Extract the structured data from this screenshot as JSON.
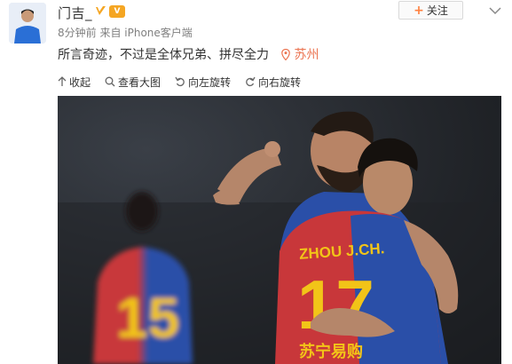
{
  "post": {
    "user_name": "门吉_",
    "vip_label": "V",
    "time": "8分钟前",
    "source": "来自 iPhone客户端",
    "follow_label": "关注",
    "text": "所言奇迹，不过是全体兄弟、拼尽全力",
    "location": "苏州"
  },
  "toolbar": {
    "collapse": "收起",
    "view_large": "查看大图",
    "rotate_left": "向左旋转",
    "rotate_right": "向右旋转"
  },
  "photo": {
    "jersey_name": "ZHOU J.CH.",
    "jersey_number_front": "17",
    "jersey_number_back": "15",
    "sponsor_text": "苏宁易购"
  },
  "colors": {
    "accent": "#eb7350",
    "follow_plus": "#ff8140",
    "jersey_blue": "#2a4fa8",
    "jersey_red": "#c8373a",
    "number_yellow": "#f2c418"
  }
}
